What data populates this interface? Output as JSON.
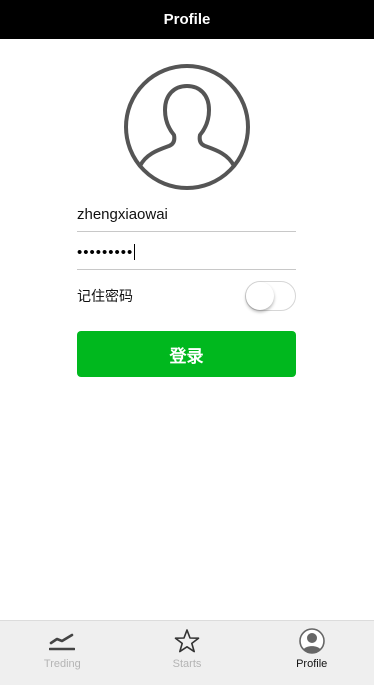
{
  "navbar": {
    "title": "Profile"
  },
  "avatar": {
    "icon": "user-avatar-icon"
  },
  "login_form": {
    "username_value": "zhengxiaowai",
    "password_value": "•••••••••",
    "remember_label": "记住密码",
    "remember_enabled": false,
    "login_label": "登录"
  },
  "tabbar": {
    "tabs": [
      {
        "label": "Treding",
        "icon": "trending-icon",
        "active": false
      },
      {
        "label": "Starts",
        "icon": "star-icon",
        "active": false
      },
      {
        "label": "Profile",
        "icon": "profile-icon",
        "active": true
      }
    ]
  },
  "colors": {
    "navbar_bg": "#000000",
    "accent_green": "#00b81e",
    "tab_inactive": "#b4b4b4",
    "tab_active": "#111111"
  }
}
